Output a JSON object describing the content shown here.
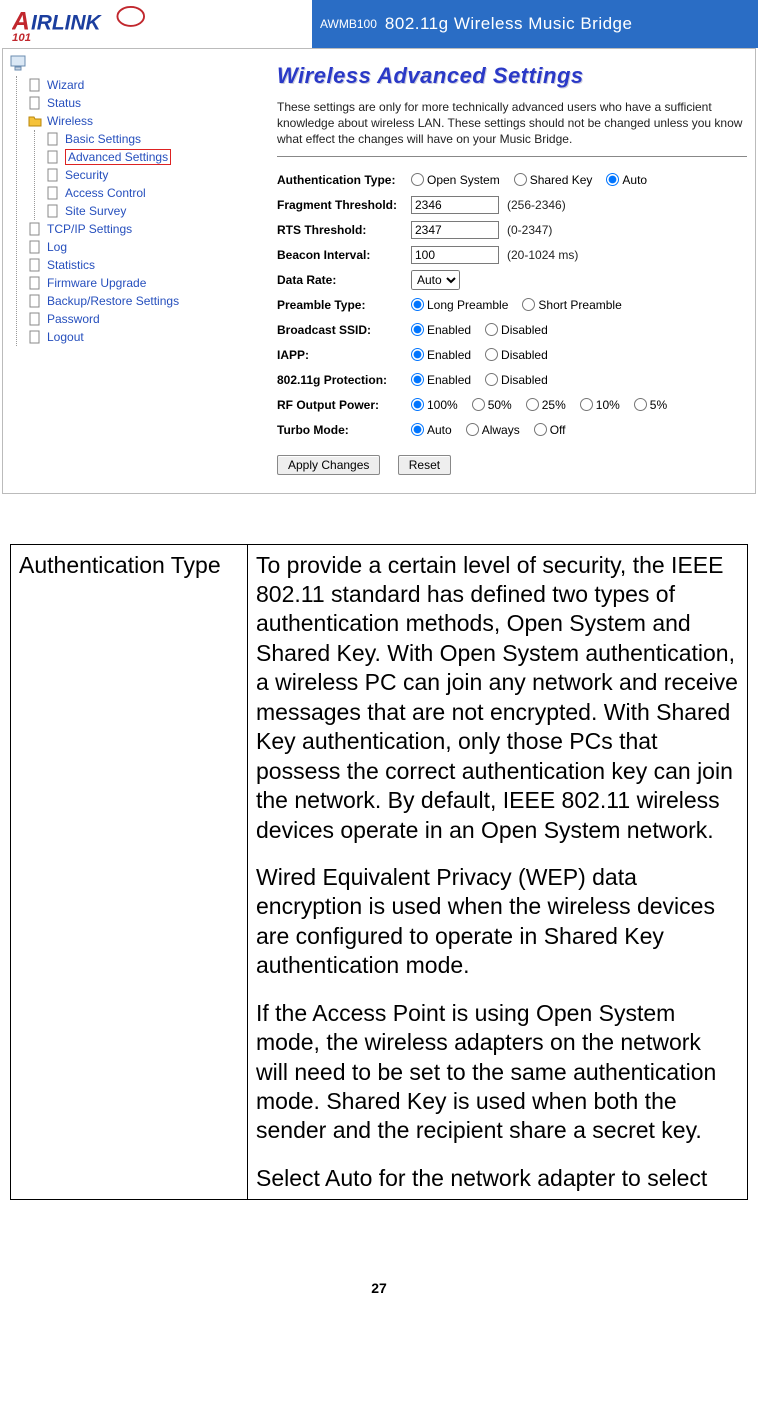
{
  "banner": {
    "model": "AWMB100",
    "title": "802.11g Wireless Music Bridge"
  },
  "nav": {
    "wizard": "Wizard",
    "status": "Status",
    "wireless": "Wireless",
    "basic_settings": "Basic Settings",
    "advanced_settings": "Advanced Settings",
    "security": "Security",
    "access_control": "Access Control",
    "site_survey": "Site Survey",
    "tcpip": "TCP/IP Settings",
    "log": "Log",
    "statistics": "Statistics",
    "firmware": "Firmware Upgrade",
    "backup": "Backup/Restore Settings",
    "password": "Password",
    "logout": "Logout"
  },
  "page": {
    "heading": "Wireless Advanced Settings",
    "desc": "These settings are only for more technically advanced users who have a sufficient knowledge about wireless LAN. These settings should not be changed unless you know what effect the changes will have on your Music Bridge."
  },
  "labels": {
    "auth_type": "Authentication Type:",
    "fragment": "Fragment Threshold:",
    "rts": "RTS Threshold:",
    "beacon": "Beacon Interval:",
    "data_rate": "Data Rate:",
    "preamble": "Preamble Type:",
    "broadcast": "Broadcast SSID:",
    "iapp": "IAPP:",
    "protection": "802.11g Protection:",
    "rf_power": "RF Output Power:",
    "turbo": "Turbo Mode:"
  },
  "options": {
    "open_system": "Open System",
    "shared_key": "Shared Key",
    "auto": "Auto",
    "long_preamble": "Long Preamble",
    "short_preamble": "Short Preamble",
    "enabled": "Enabled",
    "disabled": "Disabled",
    "p100": "100%",
    "p50": "50%",
    "p25": "25%",
    "p10": "10%",
    "p5": "5%",
    "always": "Always",
    "off": "Off",
    "data_rate_auto": "Auto"
  },
  "values": {
    "fragment": "2346",
    "rts": "2347",
    "beacon": "100"
  },
  "hints": {
    "fragment": "(256-2346)",
    "rts": "(0-2347)",
    "beacon": "(20-1024 ms)"
  },
  "buttons": {
    "apply": "Apply Changes",
    "reset": "Reset"
  },
  "doc": {
    "row_label": "Authentication Type",
    "p1": "To provide a certain level of security, the IEEE 802.11 standard has defined two types of authentication methods, Open System and Shared Key. With Open System authentication, a wireless PC can join any network and receive messages that are not encrypted. With Shared Key authentication, only those PCs that possess the correct authentication key can join the network. By default, IEEE 802.11 wireless devices operate in an Open System network.",
    "p2": "Wired Equivalent Privacy (WEP) data encryption is used when the wireless devices are configured to operate in Shared Key authentication mode.",
    "p3": "If the Access Point is using Open System mode, the wireless adapters on the network will need to be set to the same authentication mode. Shared Key is used when both the sender and the recipient share a secret key.",
    "p4": "Select Auto for the network adapter to select"
  },
  "page_number": "27"
}
